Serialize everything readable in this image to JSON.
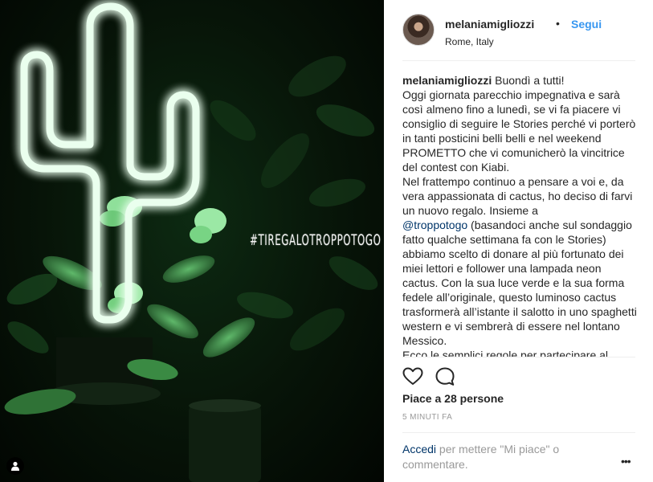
{
  "photo": {
    "overlay_text": "#TIREGALOTROPPOTOGO",
    "user_tag_icon": "person-silhouette-icon"
  },
  "post": {
    "username": "melaniamigliozzi",
    "separator": "•",
    "follow_label": "Segui",
    "location": "Rome, Italy",
    "caption_username": "melaniamigliozzi",
    "caption_lines_a": [
      "Buondì a tutti!",
      "Oggi giornata parecchio impegnativa e sarà così almeno fino a lunedì, se vi fa piacere vi consiglio di seguire le Stories perché vi porterò in tanti posticini belli belli e nel weekend PROMETTO che vi comunicherò la vincitrice del contest con Kiabi.",
      "Nel frattempo continuo a pensare a voi e, da vera appassionata di cactus, ho deciso di farvi un nuovo regalo. Insieme a"
    ],
    "caption_mention": "@troppotogo",
    "caption_after_mention": " (basandoci anche sul sondaggio fatto qualche settimana fa con le Stories) abbiamo scelto di donare al più fortunato dei miei lettori e follower una lampada neon cactus. Con la sua luce verde e la sua forma fedele all’originale, questo luminoso cactus trasformerà all’istante il salotto in uno spaghetti western e vi sembrerà di essere nel lontano Messico.",
    "caption_last": "Ecco le semplici regole per partecipare al",
    "likes_text": "Piace a 28 persone",
    "time_text": "5 MINUTI FA",
    "comment_login": "Accedi",
    "comment_rest": " per mettere \"Mi piace\" o commentare.",
    "more_label": "•••",
    "icons": {
      "like": "heart-outline-icon",
      "comment": "comment-bubble-icon",
      "more": "more-options-icon"
    },
    "colors": {
      "link": "#3897f0",
      "mention": "#003569",
      "muted": "#999999"
    }
  }
}
